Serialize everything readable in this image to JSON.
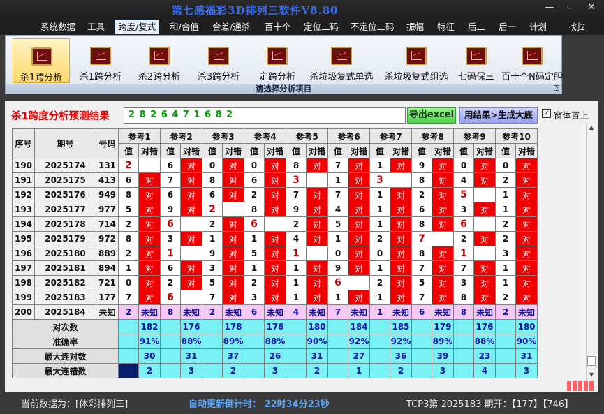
{
  "window": {
    "title": "第七感福彩3D排列三软件V8.80",
    "min": "—",
    "max": "▭",
    "close": "✕"
  },
  "menu": [
    "系统数据",
    "工具",
    "跨度/复式",
    "和/合值",
    "合差/通杀",
    "百十个",
    "定位二码",
    "不定位二码",
    "振幅",
    "特征",
    "后二",
    "后一",
    "计划",
    "·划2"
  ],
  "active_menu": "跨度/复式",
  "ribbon": {
    "buttons": [
      "杀1跨分析",
      "杀1跨分析",
      "杀2跨分析",
      "杀3跨分析",
      "定跨分析",
      "杀垃圾复式单选",
      "杀垃圾复式组选",
      "七码保三",
      "百十个N码定胆"
    ],
    "selected": 0,
    "footer": "请选择分析项目",
    "icon": "chart-icon"
  },
  "result": {
    "title": "杀1跨度分析预测结果",
    "digits": "2 8 2 6 4 7 1 6 8 2",
    "excel_btn": "导出excel",
    "gen_btn": "用结果>生成大底",
    "checkbox_label": "窗体置上",
    "checked": "✓"
  },
  "table": {
    "h1": [
      "序号",
      "期号",
      "号码"
    ],
    "ref_label": "参考",
    "ref_count": 10,
    "val_label": "值",
    "mark_label": "对错",
    "hit": "对",
    "rows": [
      {
        "seq": "190",
        "issue": "2025174",
        "num": "131",
        "refs": [
          [
            "2",
            0
          ],
          [
            "6",
            1
          ],
          [
            "0",
            1
          ],
          [
            "0",
            1
          ],
          [
            "8",
            1
          ],
          [
            "7",
            1
          ],
          [
            "1",
            1
          ],
          [
            "9",
            1
          ],
          [
            "0",
            1
          ],
          [
            "0",
            1
          ]
        ]
      },
      {
        "seq": "191",
        "issue": "2025175",
        "num": "413",
        "refs": [
          [
            "6",
            1
          ],
          [
            "7",
            1
          ],
          [
            "8",
            1
          ],
          [
            "6",
            1
          ],
          [
            "3",
            0
          ],
          [
            "1",
            1
          ],
          [
            "3",
            0
          ],
          [
            "8",
            1
          ],
          [
            "4",
            1
          ],
          [
            "2",
            1
          ]
        ]
      },
      {
        "seq": "192",
        "issue": "2025176",
        "num": "949",
        "refs": [
          [
            "8",
            1
          ],
          [
            "6",
            1
          ],
          [
            "6",
            1
          ],
          [
            "2",
            1
          ],
          [
            "7",
            1
          ],
          [
            "7",
            1
          ],
          [
            "1",
            1
          ],
          [
            "2",
            1
          ],
          [
            "5",
            0
          ],
          [
            "1",
            1
          ]
        ]
      },
      {
        "seq": "193",
        "issue": "2025177",
        "num": "977",
        "refs": [
          [
            "5",
            1
          ],
          [
            "9",
            1
          ],
          [
            "2",
            0
          ],
          [
            "8",
            1
          ],
          [
            "9",
            1
          ],
          [
            "4",
            1
          ],
          [
            "1",
            1
          ],
          [
            "6",
            1
          ],
          [
            "3",
            1
          ],
          [
            "1",
            1
          ]
        ]
      },
      {
        "seq": "194",
        "issue": "2025178",
        "num": "714",
        "refs": [
          [
            "2",
            1
          ],
          [
            "6",
            0
          ],
          [
            "2",
            1
          ],
          [
            "6",
            0
          ],
          [
            "2",
            1
          ],
          [
            "5",
            1
          ],
          [
            "1",
            1
          ],
          [
            "8",
            1
          ],
          [
            "6",
            0
          ],
          [
            "2",
            1
          ]
        ]
      },
      {
        "seq": "195",
        "issue": "2025179",
        "num": "972",
        "refs": [
          [
            "8",
            1
          ],
          [
            "3",
            1
          ],
          [
            "1",
            1
          ],
          [
            "1",
            1
          ],
          [
            "4",
            1
          ],
          [
            "1",
            1
          ],
          [
            "2",
            1
          ],
          [
            "7",
            0
          ],
          [
            "2",
            1
          ],
          [
            "2",
            1
          ]
        ]
      },
      {
        "seq": "196",
        "issue": "2025180",
        "num": "889",
        "refs": [
          [
            "2",
            1
          ],
          [
            "1",
            0
          ],
          [
            "9",
            1
          ],
          [
            "5",
            1
          ],
          [
            "1",
            0
          ],
          [
            "0",
            1
          ],
          [
            "0",
            1
          ],
          [
            "8",
            1
          ],
          [
            "1",
            0
          ],
          [
            "3",
            1
          ]
        ]
      },
      {
        "seq": "197",
        "issue": "2025181",
        "num": "894",
        "refs": [
          [
            "1",
            1
          ],
          [
            "6",
            1
          ],
          [
            "3",
            1
          ],
          [
            "1",
            1
          ],
          [
            "1",
            1
          ],
          [
            "9",
            1
          ],
          [
            "1",
            1
          ],
          [
            "7",
            1
          ],
          [
            "7",
            1
          ],
          [
            "1",
            1
          ]
        ]
      },
      {
        "seq": "198",
        "issue": "2025182",
        "num": "721",
        "refs": [
          [
            "0",
            1
          ],
          [
            "2",
            1
          ],
          [
            "5",
            1
          ],
          [
            "2",
            1
          ],
          [
            "1",
            1
          ],
          [
            "6",
            0
          ],
          [
            "2",
            1
          ],
          [
            "5",
            1
          ],
          [
            "3",
            1
          ],
          [
            "1",
            1
          ]
        ]
      },
      {
        "seq": "199",
        "issue": "2025183",
        "num": "177",
        "refs": [
          [
            "7",
            1
          ],
          [
            "6",
            0
          ],
          [
            "7",
            1
          ],
          [
            "3",
            1
          ],
          [
            "1",
            1
          ],
          [
            "1",
            1
          ],
          [
            "1",
            1
          ],
          [
            "7",
            1
          ],
          [
            "8",
            1
          ],
          [
            "2",
            1
          ]
        ]
      }
    ],
    "future": {
      "seq": "200",
      "issue": "2025184",
      "num": "未知",
      "vals": [
        "2",
        "8",
        "2",
        "6",
        "4",
        "7",
        "1",
        "6",
        "8",
        "2"
      ],
      "mark": "未知"
    },
    "stats": [
      {
        "label": "对次数",
        "vals": [
          "182",
          "176",
          "178",
          "176",
          "180",
          "184",
          "185",
          "179",
          "176",
          "180"
        ]
      },
      {
        "label": "准确率",
        "vals": [
          "91%",
          "88%",
          "89%",
          "88%",
          "90%",
          "92%",
          "92%",
          "89%",
          "88%",
          "90%"
        ]
      },
      {
        "label": "最大连对数",
        "vals": [
          "30",
          "31",
          "37",
          "26",
          "31",
          "27",
          "36",
          "39",
          "23",
          "31"
        ]
      },
      {
        "label": "最大连错数",
        "vals": [
          "2",
          "3",
          "2",
          "3",
          "2",
          "1",
          "2",
          "3",
          "4",
          "3"
        ]
      }
    ]
  },
  "statusbar": {
    "current": "当前数据为：[体彩排列三]",
    "countdown": "自动更新倒计时： 22时34分23秒",
    "period": "TCP3第 2025183 期开：【177】【746】"
  },
  "colors": {
    "hit": "#f00000",
    "future": "#f7c8f4",
    "stat": "#7af2f5",
    "cursor_cell": "#0a1f6b"
  }
}
